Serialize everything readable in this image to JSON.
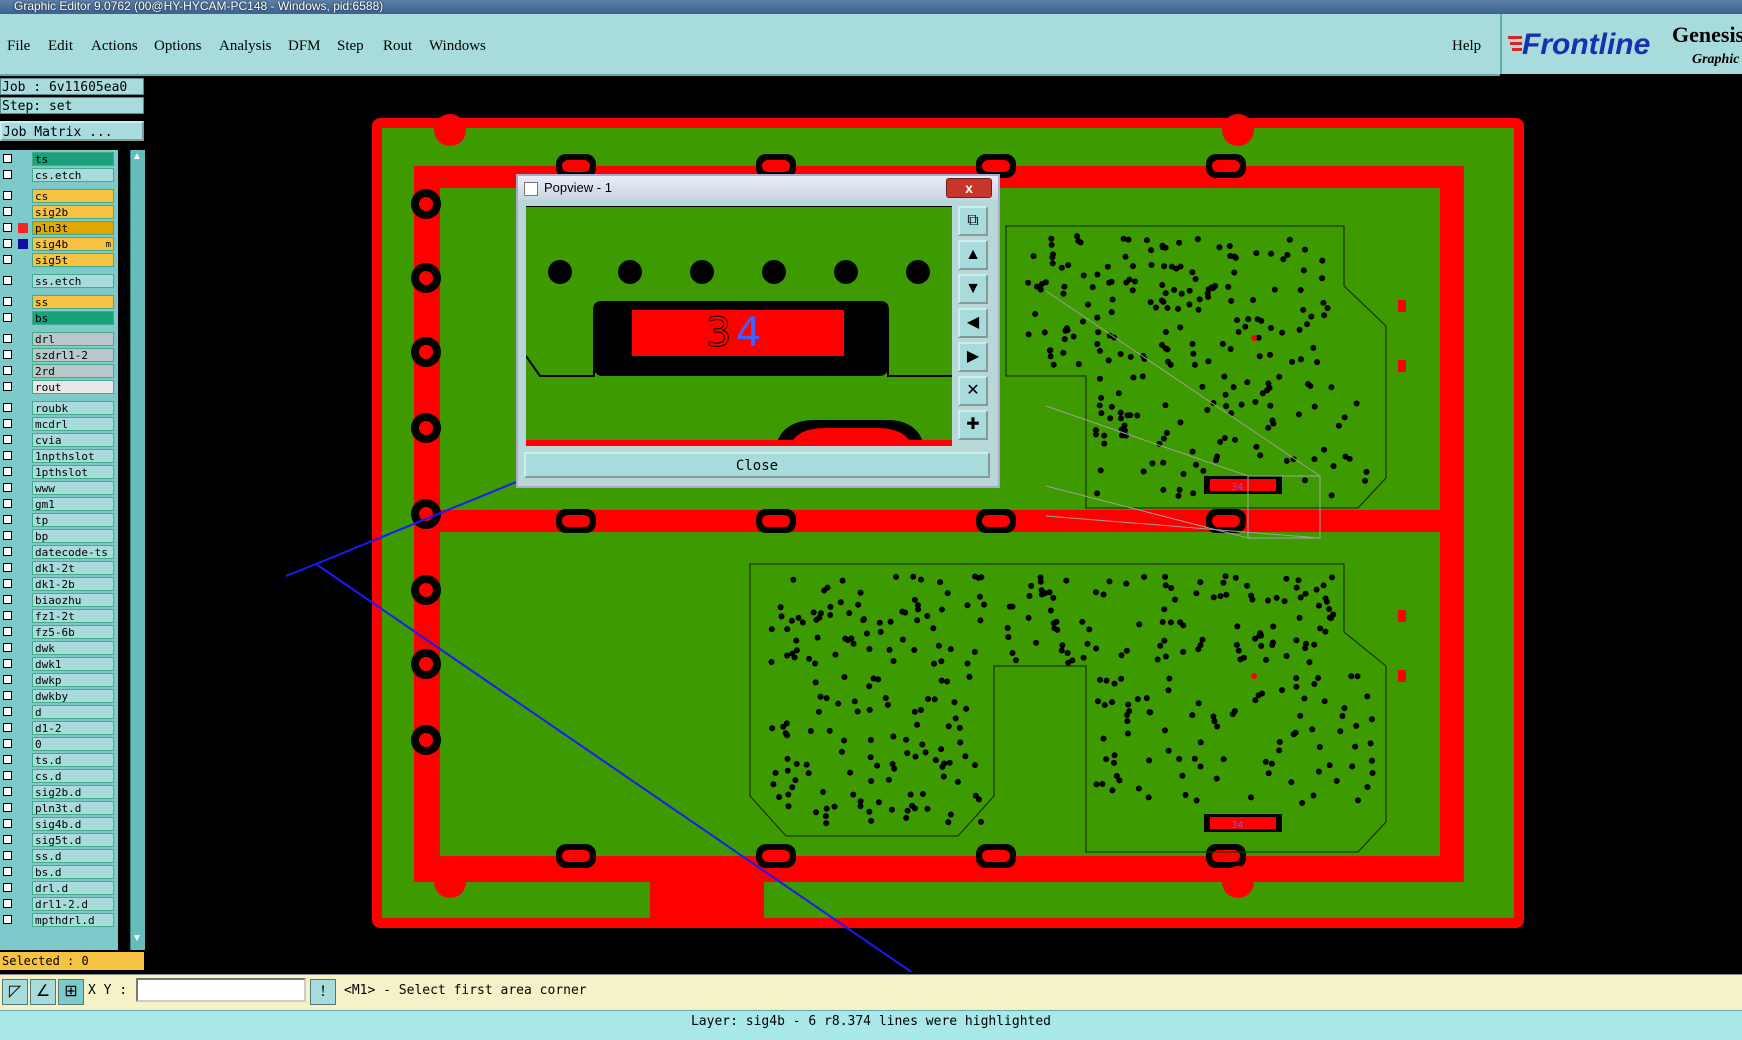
{
  "window": {
    "title": "Graphic Editor 9.0762 (00@HY-HYCAM-PC148 - Windows, pid:6588)"
  },
  "menu": {
    "items": [
      "File",
      "Edit",
      "Actions",
      "Options",
      "Analysis",
      "DFM",
      "Step",
      "Rout",
      "Windows"
    ],
    "help": "Help"
  },
  "logo": {
    "brand": "Frontline",
    "product": "Genesis",
    "sub": "Graphic"
  },
  "job": {
    "label": "Job : 6v11605ea0",
    "step": "Step: set",
    "matrix": "Job Matrix ..."
  },
  "layers": [
    {
      "name": "ts",
      "color": "#1aa07a"
    },
    {
      "name": "cs.etch",
      "color": "#a8dcdc"
    },
    {
      "name": "cs",
      "color": "#f5c242"
    },
    {
      "name": "sig2b",
      "color": "#f5c242"
    },
    {
      "name": "pln3t",
      "color": "#e0a800",
      "marker": "#ff2020"
    },
    {
      "name": "sig4b",
      "color": "#f5c242",
      "marker": "#1010a0",
      "flag": "m"
    },
    {
      "name": "sig5t",
      "color": "#f5c242"
    },
    {
      "name": "ss.etch",
      "color": "#a8dcdc"
    },
    {
      "name": "ss",
      "color": "#f5c242"
    },
    {
      "name": "bs",
      "color": "#1aa07a"
    },
    {
      "name": "drl",
      "color": "#b8c8c8"
    },
    {
      "name": "szdrl1-2",
      "color": "#b8c8c8"
    },
    {
      "name": "2rd",
      "color": "#b8c8c8"
    },
    {
      "name": "rout",
      "color": "#e8e8e8"
    },
    {
      "name": "roubk",
      "color": "#a8dcdc"
    },
    {
      "name": "mcdrl",
      "color": "#a8dcdc"
    },
    {
      "name": "cvia",
      "color": "#a8dcdc"
    },
    {
      "name": "1npthslot",
      "color": "#a8dcdc"
    },
    {
      "name": "1pthslot",
      "color": "#a8dcdc"
    },
    {
      "name": "www",
      "color": "#a8dcdc"
    },
    {
      "name": "gm1",
      "color": "#a8dcdc"
    },
    {
      "name": "tp",
      "color": "#a8dcdc"
    },
    {
      "name": "bp",
      "color": "#a8dcdc"
    },
    {
      "name": "datecode-ts",
      "color": "#a8dcdc"
    },
    {
      "name": "dk1-2t",
      "color": "#a8dcdc"
    },
    {
      "name": "dk1-2b",
      "color": "#a8dcdc"
    },
    {
      "name": "biaozhu",
      "color": "#a8dcdc"
    },
    {
      "name": "fz1-2t",
      "color": "#a8dcdc"
    },
    {
      "name": "fz5-6b",
      "color": "#a8dcdc"
    },
    {
      "name": "dwk",
      "color": "#a8dcdc"
    },
    {
      "name": "dwk1",
      "color": "#a8dcdc"
    },
    {
      "name": "dwkp",
      "color": "#a8dcdc"
    },
    {
      "name": "dwkby",
      "color": "#a8dcdc"
    },
    {
      "name": "d",
      "color": "#a8dcdc"
    },
    {
      "name": "d1-2",
      "color": "#a8dcdc"
    },
    {
      "name": "0",
      "color": "#a8dcdc"
    },
    {
      "name": "ts.d",
      "color": "#a8dcdc"
    },
    {
      "name": "cs.d",
      "color": "#a8dcdc"
    },
    {
      "name": "sig2b.d",
      "color": "#a8dcdc"
    },
    {
      "name": "pln3t.d",
      "color": "#a8dcdc"
    },
    {
      "name": "sig4b.d",
      "color": "#a8dcdc"
    },
    {
      "name": "sig5t.d",
      "color": "#a8dcdc"
    },
    {
      "name": "ss.d",
      "color": "#a8dcdc"
    },
    {
      "name": "bs.d",
      "color": "#a8dcdc"
    },
    {
      "name": "drl.d",
      "color": "#a8dcdc"
    },
    {
      "name": "drl1-2.d",
      "color": "#a8dcdc"
    },
    {
      "name": "mpthdrl.d",
      "color": "#a8dcdc"
    }
  ],
  "selected": "Selected : 0",
  "popview": {
    "title": "Popview - 1",
    "close_x": "x",
    "close_button": "Close",
    "marker_left": "3",
    "marker_right": "4"
  },
  "board_markers": {
    "top": "34",
    "bottom": "34"
  },
  "bottom": {
    "xy_label": "X Y :",
    "xy_value": "",
    "info_icon": "!",
    "prompt": "<M1> - Select first area corner"
  },
  "status": "Layer: sig4b - 6 r8.374 lines were highlighted",
  "colors": {
    "board_green": "#3d9a00",
    "copper_red": "#ff0000",
    "panel_cyan": "#a8dcdc",
    "highlight_blue": "#2244ff"
  }
}
